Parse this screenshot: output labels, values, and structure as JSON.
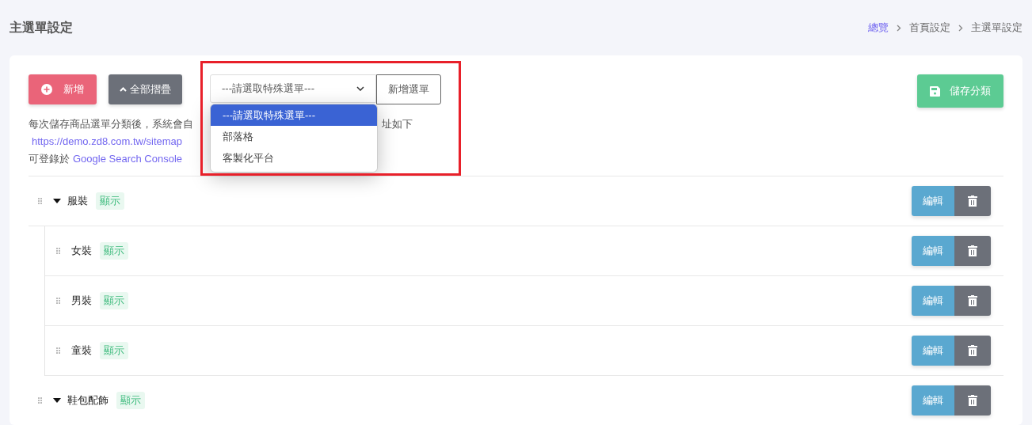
{
  "page_title": "主選單設定",
  "breadcrumb": [
    {
      "label": "總覽",
      "link": true
    },
    {
      "label": "首頁設定",
      "link": false
    },
    {
      "label": "主選單設定",
      "link": false
    }
  ],
  "toolbar": {
    "add_button": "新增",
    "collapse_button": "全部摺疊",
    "special_menu_select": {
      "value": "---請選取特殊選單---",
      "expanded": true,
      "options": [
        {
          "label": "---請選取特殊選單---",
          "selected": true
        },
        {
          "label": "部落格",
          "selected": false
        },
        {
          "label": "客製化平台",
          "selected": false
        }
      ]
    },
    "add_menu_button": "新增選單",
    "save_button": "儲存分類"
  },
  "description": [
    {
      "segments": [
        {
          "kind": "text",
          "text": "每次儲存商品選單分類後，系統會自"
        },
        {
          "kind": "covered"
        },
        {
          "kind": "text",
          "text": "址如下"
        }
      ]
    },
    {
      "segments": [
        {
          "kind": "link",
          "text": "https://demo.zd8.com.tw/sitemap"
        }
      ]
    },
    {
      "segments": [
        {
          "kind": "text",
          "text": "可登錄於 "
        },
        {
          "kind": "link",
          "text": "Google Search Console"
        }
      ]
    }
  ],
  "menu_tree": [
    {
      "name": "服裝",
      "status": "顯示",
      "expanded": true,
      "edit_button": "編輯",
      "children": [
        {
          "name": "女裝",
          "status": "顯示",
          "edit_button": "編輯"
        },
        {
          "name": "男裝",
          "status": "顯示",
          "edit_button": "編輯"
        },
        {
          "name": "童裝",
          "status": "顯示",
          "edit_button": "編輯"
        }
      ]
    },
    {
      "name": "鞋包配飾",
      "status": "顯示",
      "expanded": true,
      "edit_button": "編輯"
    }
  ]
}
